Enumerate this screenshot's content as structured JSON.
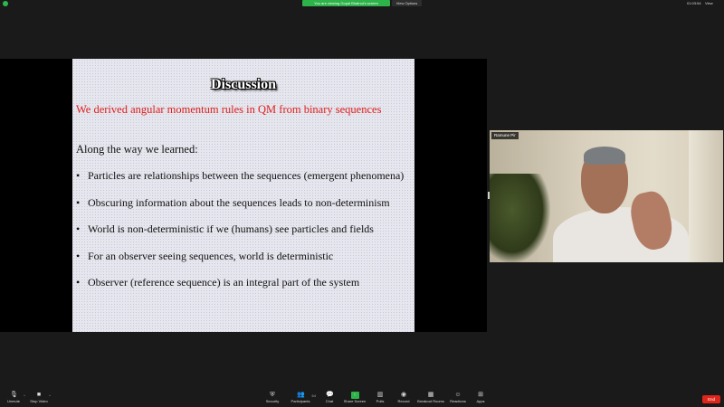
{
  "topbar": {
    "banner_text": "You are viewing Gopal Bhatnut's screen",
    "view_options_label": "View Options",
    "clock_text": "01:03:54",
    "view_label": "View"
  },
  "slide": {
    "title": "Discussion",
    "subtitle": "We derived angular momentum rules in QM from binary sequences",
    "lead": "Along the way we learned:",
    "bullet_char": "•",
    "bullets": [
      "Particles are relationships between the sequences (emergent phenomena)",
      "Obscuring information about the sequences leads to non-determinism",
      "World is non-deterministic if we (humans) see particles and fields",
      "For an observer seeing sequences, world is deterministic",
      "Observer (reference sequence) is an integral part of the system"
    ],
    "colors": {
      "subtitle": "#e0201b",
      "background": "#e6e6ee"
    }
  },
  "video": {
    "name_label": "Ramune Pir"
  },
  "toolbar": {
    "unmute_label": "Unmute",
    "stop_video_label": "Stop Video",
    "security_label": "Security",
    "participants_label": "Participants",
    "participants_count": "64",
    "chat_label": "Chat",
    "share_screen_label": "Share Screen",
    "polls_label": "Polls",
    "record_label": "Record",
    "breakout_label": "Breakout Rooms",
    "reactions_label": "Reactions",
    "apps_label": "Apps",
    "end_label": "End",
    "icons": {
      "unmute": "microphone-muted-icon",
      "video": "video-camera-icon",
      "security": "shield-icon",
      "participants": "people-icon",
      "chat": "chat-bubble-icon",
      "share": "share-screen-icon",
      "polls": "bar-chart-icon",
      "record": "record-icon",
      "breakout": "grid-icon",
      "reactions": "smiley-icon",
      "apps": "apps-icon"
    },
    "colors": {
      "share": "#2eb24a",
      "end": "#e0261b"
    }
  }
}
